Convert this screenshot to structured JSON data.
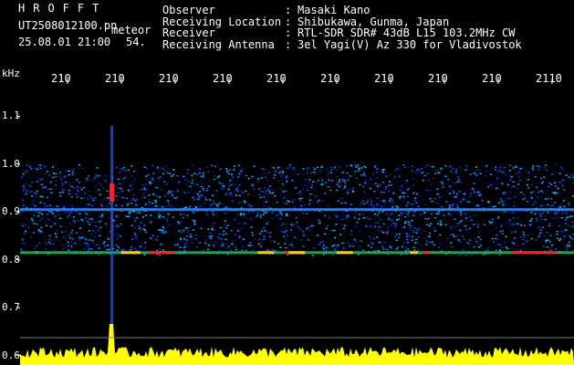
{
  "header": {
    "brand": "HROFFT",
    "filename": "UT2508012100.pn",
    "mode": "meteor",
    "datetime": "25.08.01 21:00",
    "count": "54."
  },
  "info": [
    {
      "label": "Observer",
      "sep": ":",
      "value": "Masaki Kano"
    },
    {
      "label": "Receiving Location",
      "sep": ":",
      "value": "Shibukawa, Gunma, Japan"
    },
    {
      "label": "Receiver",
      "sep": ":",
      "value": "RTL-SDR SDR# 43dB L15 103.2MHz CW"
    },
    {
      "label": "Receiving Antenna",
      "sep": ":",
      "value": "3el Yagi(V) Az 330 for Vladivostok"
    }
  ],
  "chart_data": {
    "type": "heatmap",
    "title": "",
    "x_unit_label": "",
    "y_unit_label": "kHz",
    "x_tick_labels": [
      "210",
      "210",
      "210",
      "210",
      "210",
      "210",
      "210",
      "210",
      "210",
      "2110"
    ],
    "y_ticks": [
      "1.1",
      "1.0",
      "0.9",
      "0.8",
      "0.7",
      "0.6"
    ],
    "ylim": [
      0.58,
      1.16
    ],
    "band_khz": [
      0.81,
      1.0
    ],
    "strong_lines_khz": [
      0.815,
      0.905
    ],
    "meteor_echo_time_fraction": 0.165,
    "colors": {
      "low": "#000050",
      "mid": "#0050ff",
      "high": "#ff2030",
      "level_trace": "#ffff00",
      "trace_base": "#00c8ff"
    }
  }
}
